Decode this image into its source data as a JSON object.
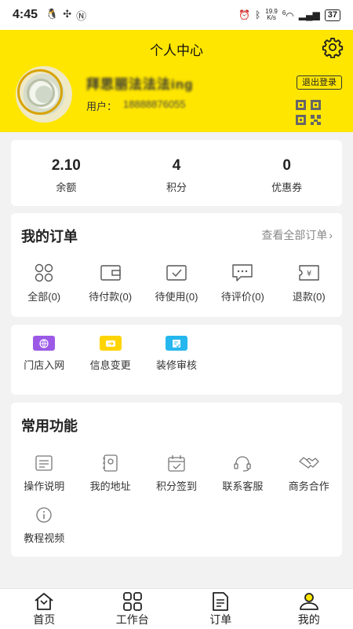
{
  "status_bar": {
    "time": "4:45",
    "speed_top": "19.9",
    "speed_bottom": "K/s",
    "signal": "6",
    "battery": "37"
  },
  "header": {
    "title": "个人中心",
    "username": "拜思丽法法法ing",
    "user_label": "用户：",
    "user_phone": "18888876055",
    "logout": "退出登录"
  },
  "stats": [
    {
      "value": "2.10",
      "label": "余额"
    },
    {
      "value": "4",
      "label": "积分"
    },
    {
      "value": "0",
      "label": "优惠券"
    }
  ],
  "orders": {
    "title": "我的订单",
    "view_all": "查看全部订单",
    "items": [
      {
        "label": "全部(0)",
        "icon": "grid-icon"
      },
      {
        "label": "待付款(0)",
        "icon": "wallet-icon"
      },
      {
        "label": "待使用(0)",
        "icon": "check-box-icon"
      },
      {
        "label": "待评价(0)",
        "icon": "comment-icon"
      },
      {
        "label": "退款(0)",
        "icon": "refund-icon"
      }
    ]
  },
  "services": {
    "items": [
      {
        "label": "门店入网",
        "icon": "globe-icon",
        "color": "#9b59e6"
      },
      {
        "label": "信息变更",
        "icon": "exchange-icon",
        "color": "#ffd400"
      },
      {
        "label": "装修审核",
        "icon": "audit-icon",
        "color": "#26b7ee"
      }
    ]
  },
  "common": {
    "title": "常用功能",
    "items": [
      {
        "label": "操作说明",
        "icon": "document-icon"
      },
      {
        "label": "我的地址",
        "icon": "address-icon"
      },
      {
        "label": "积分签到",
        "icon": "calendar-check-icon"
      },
      {
        "label": "联系客服",
        "icon": "headset-icon"
      },
      {
        "label": "商务合作",
        "icon": "handshake-icon"
      },
      {
        "label": "教程视频",
        "icon": "info-icon"
      }
    ]
  },
  "tabbar": [
    {
      "label": "首页",
      "icon": "home-icon"
    },
    {
      "label": "工作台",
      "icon": "workbench-icon"
    },
    {
      "label": "订单",
      "icon": "order-icon"
    },
    {
      "label": "我的",
      "icon": "profile-icon"
    }
  ],
  "colors": {
    "brand": "#ffe600",
    "background": "#f2f2f2"
  }
}
